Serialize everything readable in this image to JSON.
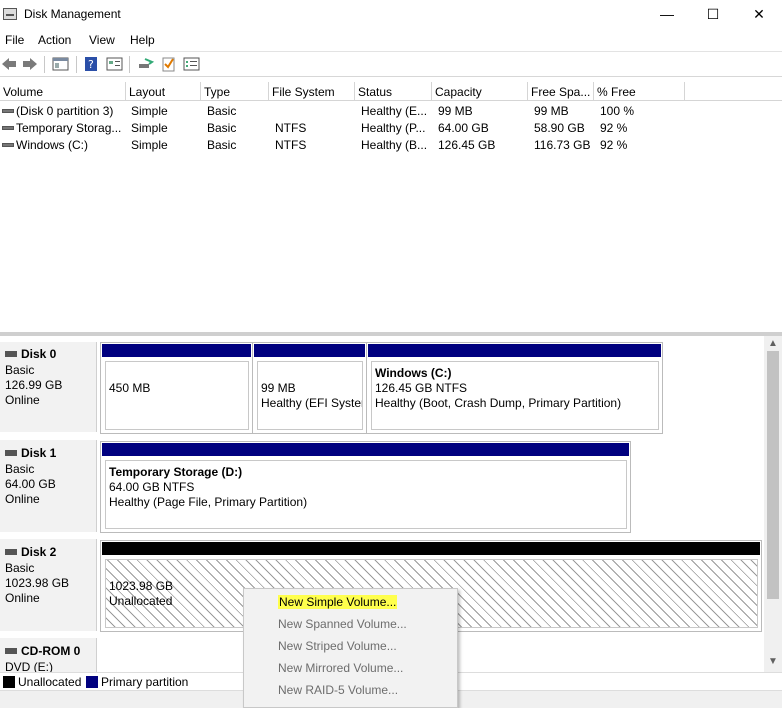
{
  "window": {
    "title": "Disk Management",
    "controls": {
      "minimize": "—",
      "maximize": "☐",
      "close": "✕"
    }
  },
  "menubar": {
    "items": [
      "File",
      "Action",
      "View",
      "Help"
    ]
  },
  "toolbar": {
    "icons": [
      "back-arrow-icon",
      "forward-arrow-icon",
      "console-tree-icon",
      "help-icon",
      "properties-icon",
      "connect-icon",
      "checklist-icon",
      "list-icon"
    ]
  },
  "volume_table": {
    "columns": [
      "Volume",
      "Layout",
      "Type",
      "File System",
      "Status",
      "Capacity",
      "Free Spa...",
      "% Free"
    ],
    "rows": [
      [
        "(Disk 0 partition 3)",
        "Simple",
        "Basic",
        "",
        "Healthy (E...",
        "99 MB",
        "99 MB",
        "100 %"
      ],
      [
        "Temporary Storag...",
        "Simple",
        "Basic",
        "NTFS",
        "Healthy (P...",
        "64.00 GB",
        "58.90 GB",
        "92 %"
      ],
      [
        "Windows (C:)",
        "Simple",
        "Basic",
        "NTFS",
        "Healthy (B...",
        "126.45 GB",
        "116.73 GB",
        "92 %"
      ]
    ]
  },
  "disks": [
    {
      "name": "Disk 0",
      "type": "Basic",
      "size": "126.99 GB",
      "status": "Online",
      "partitions": [
        {
          "title": "",
          "line1": "450 MB",
          "line2": ""
        },
        {
          "title": "",
          "line1": "99 MB",
          "line2": "Healthy (EFI System"
        },
        {
          "title": "Windows  (C:)",
          "line1": "126.45 GB NTFS",
          "line2": "Healthy (Boot, Crash Dump, Primary Partition)"
        }
      ]
    },
    {
      "name": "Disk 1",
      "type": "Basic",
      "size": "64.00 GB",
      "status": "Online",
      "partitions": [
        {
          "title": "Temporary Storage  (D:)",
          "line1": "64.00 GB NTFS",
          "line2": "Healthy (Page File, Primary Partition)"
        }
      ]
    },
    {
      "name": "Disk 2",
      "type": "Basic",
      "size": "1023.98 GB",
      "status": "Online",
      "partitions": [
        {
          "title": "",
          "line1": "1023.98 GB",
          "line2": "Unallocated"
        }
      ]
    },
    {
      "name": "CD-ROM 0",
      "type": "DVD (E:)"
    }
  ],
  "legend": {
    "items": [
      {
        "label": "Unallocated",
        "color": "#000000"
      },
      {
        "label": "Primary partition",
        "color": "#00007f"
      }
    ]
  },
  "context_menu": {
    "items": [
      {
        "label": "New Simple Volume...",
        "enabled": true,
        "highlighted": true
      },
      {
        "label": "New Spanned Volume...",
        "enabled": false
      },
      {
        "label": "New Striped Volume...",
        "enabled": false
      },
      {
        "label": "New Mirrored Volume...",
        "enabled": false
      },
      {
        "label": "New RAID-5 Volume...",
        "enabled": false
      }
    ]
  },
  "colors": {
    "primary_partition": "#00007f",
    "unallocated": "#000000",
    "highlight": "#ffff4d"
  }
}
